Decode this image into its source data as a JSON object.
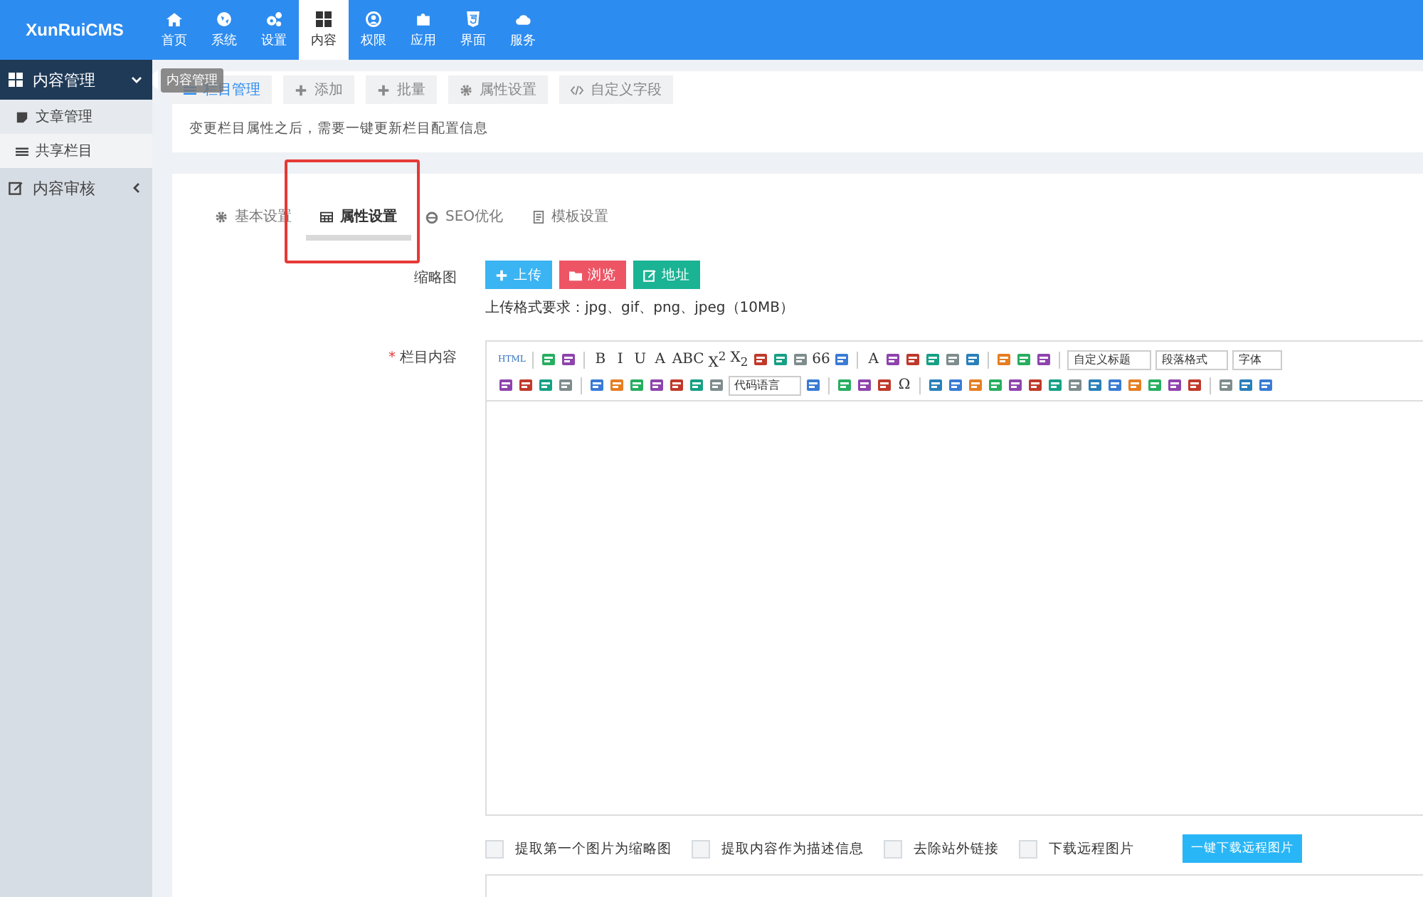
{
  "logo": {
    "text": "XunRuiCMS"
  },
  "nav": [
    {
      "label": "首页",
      "selected": false
    },
    {
      "label": "系统",
      "selected": false
    },
    {
      "label": "设置",
      "selected": false
    },
    {
      "label": "内容",
      "selected": true
    },
    {
      "label": "权限",
      "selected": false
    },
    {
      "label": "应用",
      "selected": false
    },
    {
      "label": "界面",
      "selected": false
    },
    {
      "label": "服务",
      "selected": false
    }
  ],
  "sidebar": {
    "items": [
      {
        "label": "内容管理",
        "expanded": true,
        "children": [
          {
            "label": "文章管理",
            "selected": false
          },
          {
            "label": "共享栏目",
            "selected": true
          }
        ]
      },
      {
        "label": "内容审核",
        "expanded": false
      }
    ]
  },
  "tooltip": "内容管理",
  "toolbar": [
    {
      "label": "栏目管理",
      "selected": true
    },
    {
      "label": "添加",
      "selected": false
    },
    {
      "label": "批量",
      "selected": false
    },
    {
      "label": "属性设置",
      "selected": false
    },
    {
      "label": "自定义字段",
      "selected": false
    }
  ],
  "notice": "变更栏目属性之后，需要一键更新栏目配置信息",
  "tabs": [
    {
      "label": "基本设置",
      "selected": false,
      "highlighted": false
    },
    {
      "label": "属性设置",
      "selected": true,
      "highlighted": true
    },
    {
      "label": "SEO优化",
      "selected": false,
      "highlighted": false
    },
    {
      "label": "模板设置",
      "selected": false,
      "highlighted": false
    }
  ],
  "thumbnail": {
    "label": "缩略图",
    "buttons": [
      {
        "label": "上传",
        "color": "#3ab4f2"
      },
      {
        "label": "浏览",
        "color": "#ed5565"
      },
      {
        "label": "地址",
        "color": "#1ab394"
      }
    ],
    "hint": "上传格式要求：jpg、gif、png、jpeg（10MB）"
  },
  "content": {
    "label": "栏目内容",
    "required_mark": "*",
    "toolbar": [
      [
        {
          "kind": "text",
          "label": "HTML"
        },
        {
          "kind": "sep"
        },
        {
          "kind": "icon"
        },
        {
          "kind": "icon"
        },
        {
          "kind": "sep"
        },
        {
          "kind": "text",
          "label": "B"
        },
        {
          "kind": "text",
          "label": "I"
        },
        {
          "kind": "text",
          "label": "U"
        },
        {
          "kind": "text",
          "label": "A"
        },
        {
          "kind": "text",
          "label": "ABC"
        },
        {
          "kind": "text",
          "label": "X$^{2}$"
        },
        {
          "kind": "text",
          "label": "X$_{2}$"
        },
        {
          "kind": "icon"
        },
        {
          "kind": "icon"
        },
        {
          "kind": "icon"
        },
        {
          "kind": "text",
          "label": "66"
        },
        {
          "kind": "icon"
        },
        {
          "kind": "sep"
        },
        {
          "kind": "text",
          "label": "A"
        },
        {
          "kind": "icon"
        },
        {
          "kind": "icon"
        },
        {
          "kind": "icon"
        },
        {
          "kind": "icon"
        },
        {
          "kind": "icon"
        },
        {
          "kind": "sep"
        },
        {
          "kind": "icon"
        },
        {
          "kind": "icon"
        },
        {
          "kind": "icon"
        },
        {
          "kind": "sep"
        },
        {
          "kind": "select",
          "label": "自定义标题"
        },
        {
          "kind": "select",
          "label": "段落格式"
        },
        {
          "kind": "select",
          "label": "字体"
        }
      ],
      [
        {
          "kind": "icon"
        },
        {
          "kind": "icon"
        },
        {
          "kind": "icon"
        },
        {
          "kind": "icon"
        },
        {
          "kind": "sep"
        },
        {
          "kind": "icon"
        },
        {
          "kind": "icon"
        },
        {
          "kind": "icon"
        },
        {
          "kind": "icon"
        },
        {
          "kind": "icon"
        },
        {
          "kind": "icon"
        },
        {
          "kind": "icon"
        },
        {
          "kind": "select",
          "label": "代码语言"
        },
        {
          "kind": "icon"
        },
        {
          "kind": "sep"
        },
        {
          "kind": "icon"
        },
        {
          "kind": "icon"
        },
        {
          "kind": "icon"
        },
        {
          "kind": "text",
          "label": "Ω"
        },
        {
          "kind": "sep"
        },
        {
          "kind": "icon"
        },
        {
          "kind": "icon"
        },
        {
          "kind": "icon"
        },
        {
          "kind": "icon"
        },
        {
          "kind": "icon"
        },
        {
          "kind": "icon"
        },
        {
          "kind": "icon"
        },
        {
          "kind": "icon"
        },
        {
          "kind": "icon"
        },
        {
          "kind": "icon"
        },
        {
          "kind": "icon"
        },
        {
          "kind": "icon"
        },
        {
          "kind": "icon"
        },
        {
          "kind": "icon"
        },
        {
          "kind": "sep"
        },
        {
          "kind": "icon"
        },
        {
          "kind": "icon"
        },
        {
          "kind": "icon"
        }
      ]
    ],
    "options": [
      {
        "label": "提取第一个图片为缩略图",
        "checked": false
      },
      {
        "label": "提取内容作为描述信息",
        "checked": false
      },
      {
        "label": "去除站外链接",
        "checked": false
      },
      {
        "label": "下载远程图片",
        "checked": false
      }
    ],
    "action": "一键下载远程图片"
  }
}
